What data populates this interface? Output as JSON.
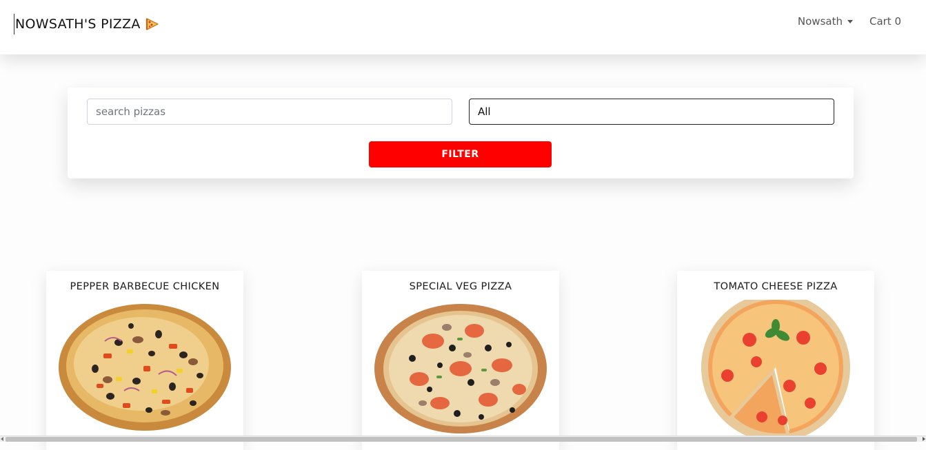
{
  "navbar": {
    "brand": "NOWSATH'S PIZZA",
    "brand_icon": "pizza-slice-icon",
    "user_menu_label": "Nowsath",
    "cart_label": "Cart 0"
  },
  "filter": {
    "search_placeholder": "search pizzas",
    "search_value": "",
    "category_selected": "All",
    "filter_button_label": "FILTER"
  },
  "pizzas": [
    {
      "name": "PEPPER BARBECUE CHICKEN",
      "image_icon": "pepper-barbecue-chicken-pizza-image"
    },
    {
      "name": "SPECIAL VEG PIZZA",
      "image_icon": "special-veg-pizza-image"
    },
    {
      "name": "TOMATO CHEESE PIZZA",
      "image_icon": "tomato-cheese-pizza-image"
    }
  ],
  "colors": {
    "accent_red": "#ff0000",
    "background": "#fdfdfd",
    "navbar": "#ffffff"
  }
}
